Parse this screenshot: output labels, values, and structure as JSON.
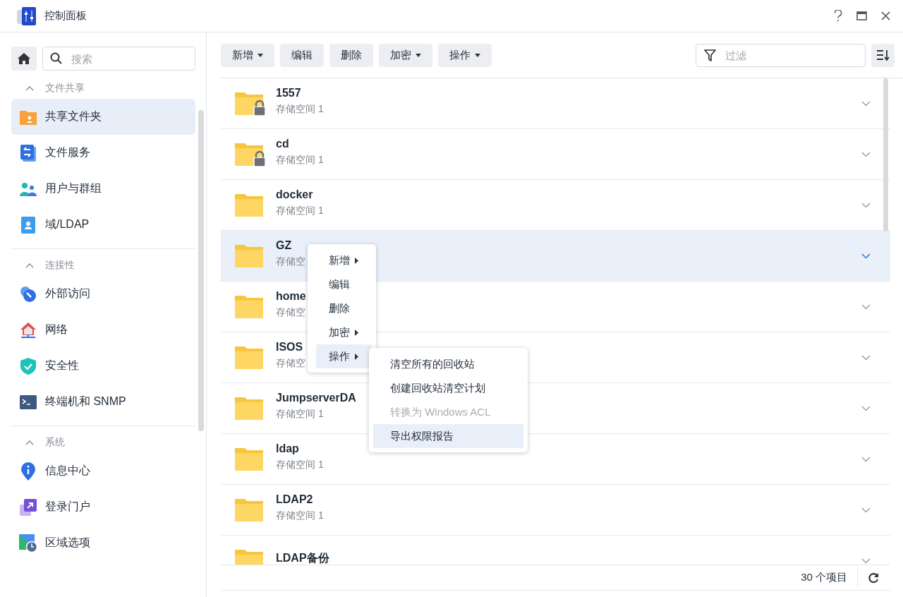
{
  "window": {
    "title": "控制面板"
  },
  "sidebar": {
    "search": {
      "placeholder": "搜索"
    },
    "sections": [
      {
        "title": "文件共享",
        "expanded": true,
        "items": [
          {
            "label": "共享文件夹",
            "selected": true
          },
          {
            "label": "文件服务",
            "selected": false
          },
          {
            "label": "用户与群组",
            "selected": false
          },
          {
            "label": "域/LDAP",
            "selected": false
          }
        ]
      },
      {
        "title": "连接性",
        "expanded": true,
        "items": [
          {
            "label": "外部访问",
            "selected": false
          },
          {
            "label": "网络",
            "selected": false
          },
          {
            "label": "安全性",
            "selected": false
          },
          {
            "label": "终端机和 SNMP",
            "selected": false
          }
        ]
      },
      {
        "title": "系统",
        "expanded": true,
        "items": [
          {
            "label": "信息中心",
            "selected": false
          },
          {
            "label": "登录门户",
            "selected": false
          },
          {
            "label": "区域选项",
            "selected": false
          }
        ]
      }
    ]
  },
  "toolbar": {
    "buttons": [
      {
        "label": "新增",
        "dropdown": true
      },
      {
        "label": "编辑",
        "dropdown": false
      },
      {
        "label": "删除",
        "dropdown": false
      },
      {
        "label": "加密",
        "dropdown": true
      },
      {
        "label": "操作",
        "dropdown": true
      }
    ],
    "filter": {
      "placeholder": "过滤"
    }
  },
  "folders": [
    {
      "name": "1557",
      "storage": "存储空间 1",
      "locked": true,
      "selected": false
    },
    {
      "name": "cd",
      "storage": "存储空间 1",
      "locked": true,
      "selected": false
    },
    {
      "name": "docker",
      "storage": "存储空间 1",
      "locked": false,
      "selected": false
    },
    {
      "name": "GZ",
      "storage": "存储空",
      "locked": false,
      "selected": true
    },
    {
      "name": "home",
      "storage": "存储空",
      "locked": false,
      "selected": false
    },
    {
      "name": "ISOS",
      "storage": "存储空",
      "locked": false,
      "selected": false
    },
    {
      "name": "JumpserverDA",
      "storage": "存储空间 1",
      "locked": false,
      "selected": false
    },
    {
      "name": "ldap",
      "storage": "存储空间 1",
      "locked": false,
      "selected": false
    },
    {
      "name": "LDAP2",
      "storage": "存储空间 1",
      "locked": false,
      "selected": false
    },
    {
      "name": "LDAP备份",
      "locked": false,
      "selected": false
    }
  ],
  "status_bar": {
    "count": "30 个项目"
  },
  "context_menu": {
    "items": [
      {
        "label": "新增",
        "submenu": true,
        "selected": false
      },
      {
        "label": "编辑",
        "submenu": false,
        "selected": false
      },
      {
        "label": "删除",
        "submenu": false,
        "selected": false
      },
      {
        "label": "加密",
        "submenu": true,
        "selected": false
      },
      {
        "label": "操作",
        "submenu": true,
        "selected": true
      }
    ],
    "submenu": [
      {
        "label": "清空所有的回收站",
        "disabled": false,
        "selected": false
      },
      {
        "label": "创建回收站清空计划",
        "disabled": false,
        "selected": false
      },
      {
        "label": "转换为 Windows ACL",
        "disabled": true,
        "selected": false
      },
      {
        "label": "导出权限报告",
        "disabled": false,
        "selected": true
      }
    ]
  }
}
